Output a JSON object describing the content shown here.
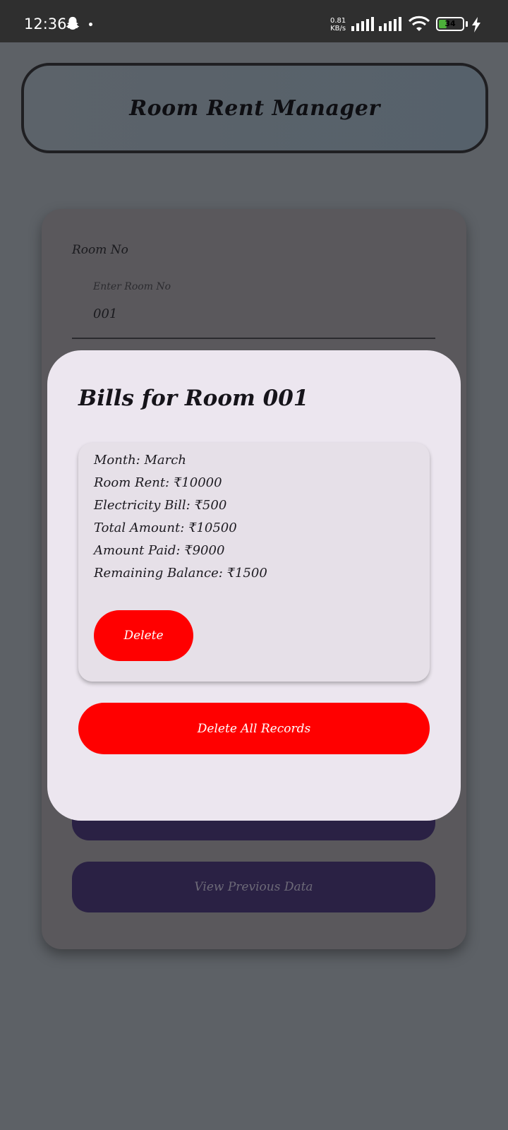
{
  "status_bar": {
    "time": "12:36",
    "net_speed_value": "0.81",
    "net_speed_unit": "KB/s",
    "battery_percent": "34",
    "battery_level": 0.34,
    "icons": [
      "snapchat-ghost-icon",
      "notification-dot-icon",
      "signal-icon",
      "signal-icon",
      "wifi-icon",
      "battery-icon",
      "charging-bolt-icon"
    ]
  },
  "header": {
    "title": "Room Rent Manager"
  },
  "form": {
    "room_label": "Room No",
    "input_label": "Enter Room No",
    "input_value": "001",
    "view_previous_label": "View Previous Data"
  },
  "dialog": {
    "title": "Bills for Room 001",
    "bill": {
      "month": "Month: March",
      "room_rent": "Room Rent: ₹10000",
      "electricity": "Electricity Bill: ₹500",
      "total": "Total Amount: ₹10500",
      "paid": "Amount Paid: ₹9000",
      "remaining": "Remaining Balance: ₹1500",
      "delete_label": "Delete"
    },
    "delete_all_label": "Delete All Records"
  },
  "colors": {
    "status_bar_bg": "#2f2f2f",
    "scrim": "#5d6166",
    "dialog_bg": "#ece6ef",
    "danger": "#ff0000",
    "primary_dark": "#2a2144",
    "battery_fill": "#4caf3a"
  }
}
